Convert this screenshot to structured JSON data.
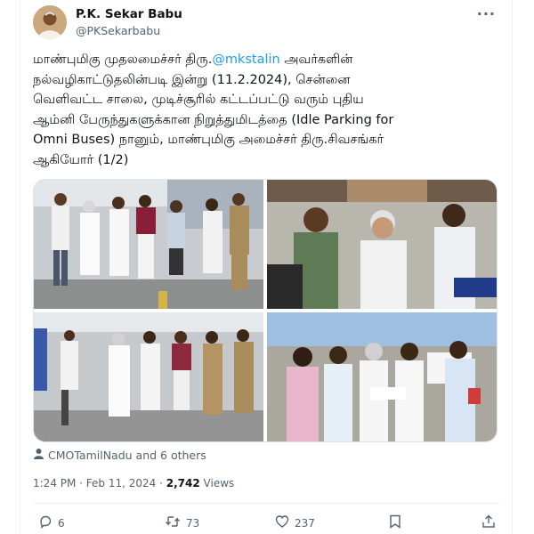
{
  "author": {
    "name": "P.K. Sekar Babu",
    "handle": "@PKSekarbabu"
  },
  "tweet": {
    "text_before_mention": "மாண்புமிகு முதலமைச்சர் திரு.",
    "mention": "@mkstalin",
    "text_after_mention": " அவர்களின்\nநல்வழிகாட்டுதலின்படி இன்று (11.2.2024), சென்னை\nவெளிவட்ட சாலை, முடிச்சூரில் கட்டப்பட்டு வரும் புதிய\nஆம்னி பேருந்துகளுக்கான நிறுத்துமிடத்தை (Idle Parking for\nOmni Buses) நானும், மாண்புமிகு அமைச்சர் திரு.சிவசங்கர்\nஆகியோர் (1/2)"
  },
  "tagged": "CMOTamilNadu and 6 others",
  "meta": {
    "timestamp": "1:24 PM · Feb 11, 2024 · ",
    "views_count": "2,742",
    "views_label": " Views"
  },
  "actions": {
    "replies": "6",
    "reposts": "73",
    "likes": "237"
  },
  "icons": {
    "more": "more-icon",
    "person": "person-icon",
    "reply": "reply-icon",
    "repost": "repost-icon",
    "like": "heart-icon",
    "bookmark": "bookmark-icon",
    "share": "share-icon"
  }
}
